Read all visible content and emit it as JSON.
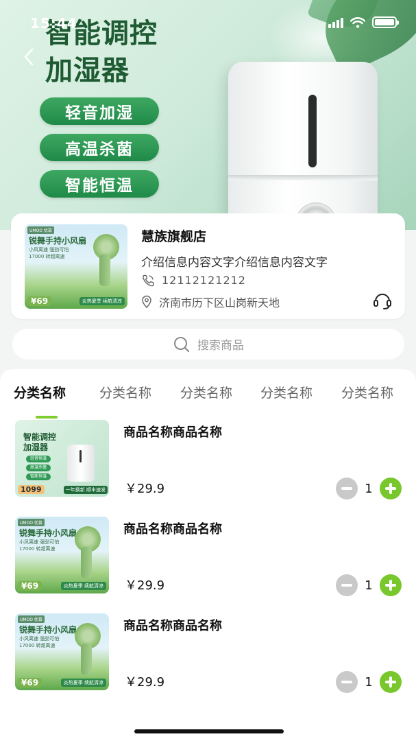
{
  "status_bar": {
    "time": "15:44"
  },
  "hero": {
    "title_line1": "智能调控",
    "title_line2": "加湿器",
    "features": [
      "轻音加湿",
      "高温杀菌",
      "智能恒温"
    ]
  },
  "store": {
    "name": "慧族旗舰店",
    "description": "介绍信息内容文字介绍信息内容文字",
    "phone": "12112121212",
    "address": "济南市历下区山岗新天地",
    "thumb": {
      "title": "锐舞手持小风扇",
      "sub1": "小风离速 强劲可怕",
      "sub2": "17000 转超离速",
      "price": "¥69",
      "footer": "炎热夏季 续航清凉"
    }
  },
  "search": {
    "placeholder": "搜索商品"
  },
  "tabs": [
    "分类名称",
    "分类名称",
    "分类名称",
    "分类名称",
    "分类名称"
  ],
  "products": [
    {
      "name": "商品名称商品名称",
      "price": "￥29.9",
      "qty": "1",
      "art": {
        "title_line1": "智能调控",
        "title_line2": "加湿器",
        "chips": [
          "轻音恒温",
          "高温杀菌",
          "智能恒温"
        ],
        "price": "1099",
        "footer": "一年换新 顺丰速发"
      }
    },
    {
      "name": "商品名称商品名称",
      "price": "￥29.9",
      "qty": "1",
      "art": {
        "title": "锐舞手持小风扇",
        "sub1": "小风离速 强劲可怕",
        "sub2": "17000 转超离速",
        "price": "¥69",
        "footer": "炎热夏季 续航清凉"
      }
    },
    {
      "name": "商品名称商品名称",
      "price": "￥29.9",
      "qty": "1",
      "art": {
        "title": "锐舞手持小风扇",
        "sub1": "小风离速 强劲可怕",
        "sub2": "17000 转超离速",
        "price": "¥69",
        "footer": "炎热夏季 续航清凉"
      }
    }
  ],
  "colors": {
    "accent": "#78c72c",
    "hero_green": "#1f8a48",
    "minus_gray": "#c9c9c9"
  }
}
